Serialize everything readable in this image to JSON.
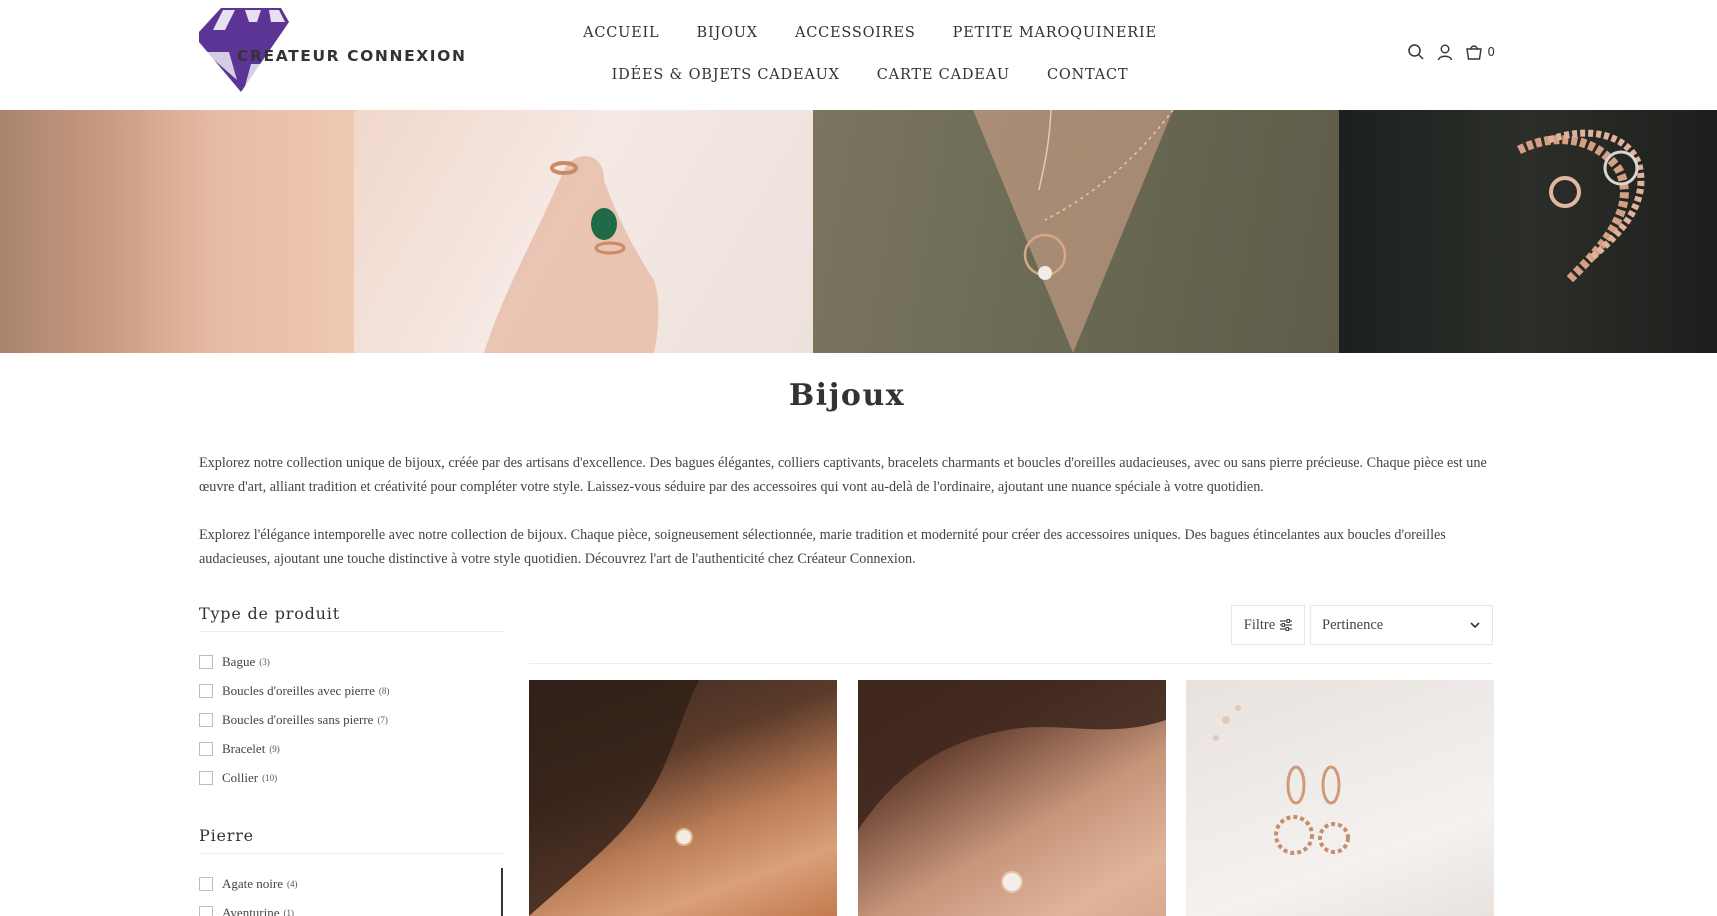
{
  "brand": {
    "name": "CREATEUR CONNEXION",
    "logo_color": "#5b3496"
  },
  "nav": {
    "row1": [
      "ACCUEIL",
      "BIJOUX",
      "ACCESSOIRES",
      "PETITE MAROQUINERIE"
    ],
    "row2": [
      "IDÉES & OBJETS CADEAUX",
      "CARTE CADEAU",
      "CONTACT"
    ]
  },
  "header_icons": {
    "search": "search-icon",
    "account": "user-icon",
    "cart": "cart-icon",
    "cart_count": "0"
  },
  "page": {
    "title": "Bijoux",
    "description_1": "Explorez notre collection unique de bijoux, créée par des artisans d'excellence. Des bagues élégantes, colliers captivants, bracelets charmants et boucles d'oreilles audacieuses, avec ou sans pierre précieuse. Chaque pièce est une œuvre d'art, alliant tradition et créativité pour compléter votre style. Laissez-vous séduire par des accessoires qui vont au-delà de l'ordinaire, ajoutant une nuance spéciale à votre quotidien.",
    "description_2": "Explorez l'élégance intemporelle avec notre collection de bijoux. Chaque pièce, soigneusement sélectionnée, marie tradition et modernité pour créer des accessoires uniques. Des bagues étincelantes aux boucles d'oreilles audacieuses, ajoutant une touche distinctive à votre style quotidien. Découvrez l'art de l'authenticité chez Créateur Connexion."
  },
  "filters": {
    "type": {
      "title": "Type de produit",
      "items": [
        {
          "label": "Bague",
          "count": "(3)"
        },
        {
          "label": "Boucles d'oreilles avec pierre",
          "count": "(8)"
        },
        {
          "label": "Boucles d'oreilles sans pierre",
          "count": "(7)"
        },
        {
          "label": "Bracelet",
          "count": "(9)"
        },
        {
          "label": "Collier",
          "count": "(10)"
        }
      ]
    },
    "stone": {
      "title": "Pierre",
      "items": [
        {
          "label": "Agate noire",
          "count": "(4)"
        },
        {
          "label": "Aventurine",
          "count": "(1)"
        }
      ]
    }
  },
  "toolbar": {
    "filter_label": "Filtre",
    "sort_value": "Pertinence"
  }
}
